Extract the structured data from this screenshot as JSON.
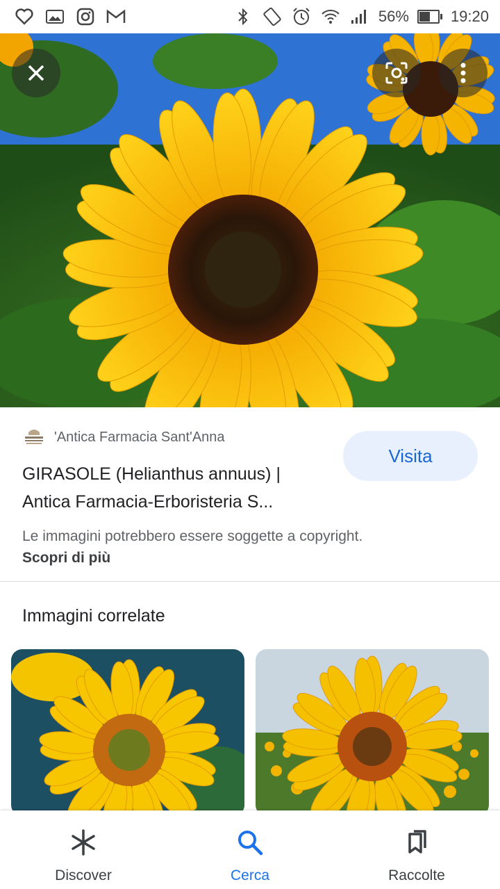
{
  "status_bar": {
    "icons_left": [
      "heart-icon",
      "image-icon",
      "instagram-icon",
      "gmail-icon"
    ],
    "icons_right": [
      "bluetooth-icon",
      "rotate-icon",
      "alarm-icon",
      "wifi-icon",
      "signal-icon"
    ],
    "battery_percent": "56%",
    "battery_level": 0.56,
    "time": "19:20"
  },
  "viewer": {
    "close_icon": "close-icon",
    "lens_icon": "lens-icon",
    "more_icon": "more-vertical-icon"
  },
  "source": {
    "site_name": "'Antica Farmacia Sant'Anna",
    "title_line1": "GIRASOLE (Helianthus annuus) |",
    "title_line2": "Antica Farmacia-Erboristeria S...",
    "visit_label": "Visita",
    "copyright_text": "Le immagini potrebbero essere soggette a copyright.",
    "learn_more": "Scopri di più"
  },
  "related": {
    "title": "Immagini correlate"
  },
  "bottom_nav": {
    "items": [
      {
        "label": "Discover",
        "icon": "asterisk-icon"
      },
      {
        "label": "Cerca",
        "icon": "search-icon"
      },
      {
        "label": "Raccolte",
        "icon": "collections-icon"
      }
    ],
    "active": "Cerca"
  },
  "colors": {
    "accent": "#1a73e8",
    "visit_bg": "#e8f0fe",
    "visit_text": "#1967d2"
  }
}
